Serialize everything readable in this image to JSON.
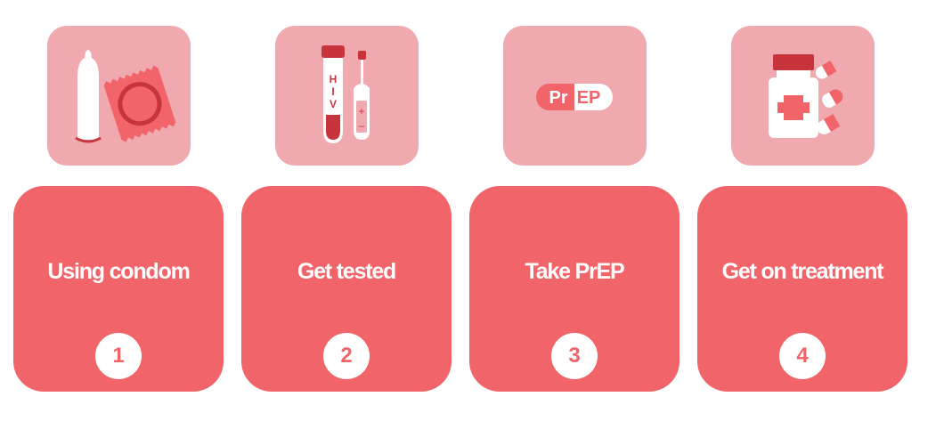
{
  "colors": {
    "icon_bg": "#f0a9ae",
    "card_bg": "#f1646a",
    "accent_dark": "#c8343c",
    "white": "#ffffff"
  },
  "steps": [
    {
      "label": "Using condom",
      "number": "1",
      "icon": "condom-icon"
    },
    {
      "label": "Get tested",
      "number": "2",
      "icon": "hiv-test-icon"
    },
    {
      "label": "Take PrEP",
      "number": "3",
      "icon": "prep-pill-icon"
    },
    {
      "label": "Get on treatment",
      "number": "4",
      "icon": "medicine-bottle-icon"
    }
  ],
  "icon_text": {
    "hiv_letters": [
      "H",
      "I",
      "V"
    ],
    "test_marks": [
      "+",
      "–"
    ],
    "prep_left": "Pr",
    "prep_right": "EP"
  }
}
